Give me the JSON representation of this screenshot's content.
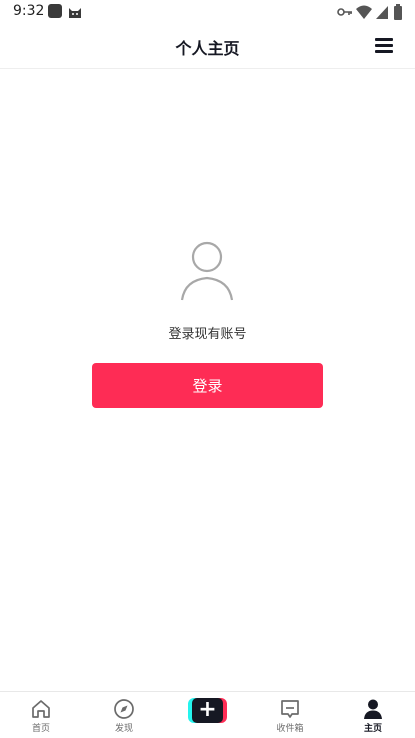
{
  "status_bar": {
    "time": "9:32",
    "icons": [
      "app-square-icon",
      "cat-icon",
      "key-icon",
      "wifi-icon",
      "signal-icon",
      "battery-icon"
    ]
  },
  "header": {
    "title": "个人主页",
    "menu_icon": "hamburger-menu-icon"
  },
  "main": {
    "avatar_icon": "user-avatar-icon",
    "prompt": "登录现有账号",
    "login_label": "登录",
    "accent_color": "#fe2c55"
  },
  "bottom_nav": {
    "items": [
      {
        "label": "首页",
        "icon": "home-icon"
      },
      {
        "label": "发现",
        "icon": "compass-icon"
      },
      {
        "label": "",
        "icon": "create-plus-icon"
      },
      {
        "label": "收件箱",
        "icon": "inbox-icon"
      },
      {
        "label": "主页",
        "icon": "profile-icon",
        "active": true
      }
    ]
  }
}
